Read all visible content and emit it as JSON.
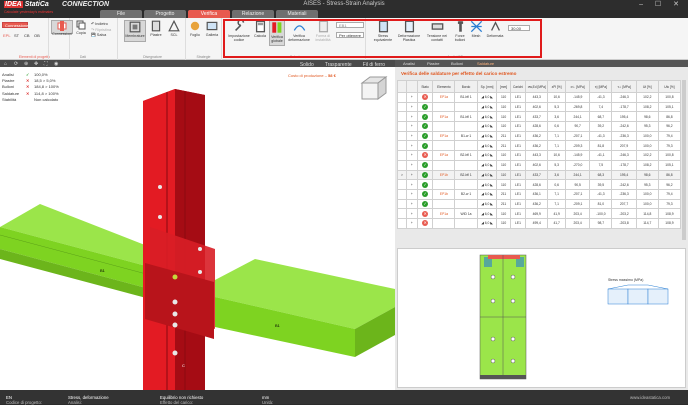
{
  "app": {
    "logo_ide": "IDEA",
    "logo_statica": "StatiCa",
    "logo_connection": "CONNECTION",
    "tagline": "Calculate yesterday's estimates",
    "window_title": "AISES - Stress-Strain Analysis",
    "window_controls": "– ☐ ✕"
  },
  "tabs": [
    "File",
    "Progetto",
    "Verifica",
    "Relazione",
    "Materiali"
  ],
  "ribbon": {
    "project_items": {
      "connection": "Connessione 1",
      "codes": [
        "EPL",
        "ST",
        "CB",
        "OB"
      ],
      "caption": "Elementi di progetto"
    },
    "data_group": {
      "connection_btn": "Connessioni",
      "copy_btn": "Copia",
      "indietro": "Indietro",
      "ripristina": "Ripristina",
      "salva": "Salva",
      "caption": "Dati"
    },
    "display_group": {
      "btn1": "Membrature",
      "btn2": "Piastre",
      "btn3": "SCL",
      "caption": "Disegnatore"
    },
    "view_group": {
      "btn1": "Foglio",
      "btn2": "Galleria",
      "caption": "Strategie"
    },
    "calc_group": {
      "btn_impostazione": "Impostazione codice",
      "btn_calcola": "Calcola",
      "btn_verifica_globale": "Verifica globale",
      "btn_verifica_deform": "Verifica deformazione",
      "btn_forma": "Forma di instabilità",
      "combo_material": "EB1",
      "combo_loadcase": "Per ottenere",
      "caption": "Calcolo"
    },
    "results_group": {
      "btn_stress": "Stress equivalente",
      "btn_deform": "Deformazione Plastica",
      "btn_tension": "Tensione nei contatti",
      "btn_forces": "Forze bulloni",
      "btn_mesh": "Mesh",
      "btn_deformed": "Deformata",
      "scale_value": "30.00",
      "caption": "Analisi EF"
    }
  },
  "viewport": {
    "toolbar_icons": [
      "house-icon",
      "rotate-icon",
      "zoom-icon",
      "pan-icon",
      "fit-icon",
      "camera-icon"
    ],
    "right_tabs": [
      "Solido",
      "Trasparente",
      "Fil di ferro"
    ],
    "production_cost_label": "Costo di produzione",
    "production_cost_value": "58 €",
    "member_labels": [
      "B1",
      "B1",
      "C"
    ]
  },
  "status": [
    {
      "label": "Analisi",
      "state": "ok",
      "value": "100,0%"
    },
    {
      "label": "Piastre",
      "state": "bad",
      "value": "18,5 > 5,0%"
    },
    {
      "label": "Bulloni",
      "state": "bad",
      "value": "184,8 > 100%"
    },
    {
      "label": "Saldature",
      "state": "bad",
      "value": "114,8 > 100%"
    },
    {
      "label": "Stabilità",
      "state": "none",
      "value": "Non calcolato"
    }
  ],
  "right_tabs": [
    "Analisi",
    "Piastre",
    "Bulloni",
    "Saldature"
  ],
  "right_active_tab": "Saldature",
  "table": {
    "title": "Verifica delle saldature per effetto del carico estremo",
    "headers": [
      "",
      "",
      "Stato",
      "Elemento",
      "Bordo",
      "Sp. [mm]",
      "[mm]",
      "Carichi",
      "σw,Ed [MPa]",
      "εPl [%]",
      "σ⊥ [MPa]",
      "τ∥ [MPa]",
      "τ⊥ [MPa]",
      "Ut [%]",
      "Utc [%]"
    ],
    "rows": [
      [
        "",
        "+",
        "bad",
        "EP1a",
        "B1-bfl 1",
        "◢ 6,0 ◣",
        "110",
        "LE1",
        "443,3",
        "10,6",
        "-145,9",
        "-41,3",
        "-246,3",
        "102,2",
        "100,8"
      ],
      [
        "",
        "+",
        "ok",
        "",
        "",
        "◢ 6,0 ◣",
        "110",
        "LE1",
        "402,6",
        "5,3",
        "-269,8",
        "7,4",
        "-178,7",
        "108,2",
        "105,1"
      ],
      [
        "",
        "+",
        "ok",
        "EP1a",
        "B1-bfl 1",
        "◢ 6,0 ◣",
        "110",
        "LE1",
        "433,7",
        "3,6",
        "244,1",
        "68,7",
        "195,4",
        "98,6",
        "86,8"
      ],
      [
        "",
        "+",
        "ok",
        "",
        "",
        "◢ 6,0 ◣",
        "110",
        "LE1",
        "428,6",
        "0,6",
        "90,7",
        "39,2",
        "-242,6",
        "95,3",
        "96,2"
      ],
      [
        "",
        "+",
        "ok",
        "EP1a",
        "B1-w 1",
        "◢ 6,0 ◣",
        "211",
        "LE1",
        "436,2",
        "7,1",
        "-207,1",
        "-41,3",
        "-236,3",
        "100,0",
        "79,4"
      ],
      [
        "",
        "+",
        "ok",
        "",
        "",
        "◢ 6,0 ◣",
        "211",
        "LE1",
        "436,2",
        "7,1",
        "-209,3",
        "81,8",
        "207,9",
        "100,0",
        "79,3"
      ],
      [
        "",
        "+",
        "bad",
        "EP1a",
        "B2-bfl 1",
        "◢ 6,0 ◣",
        "110",
        "LE1",
        "443,3",
        "10,6",
        "-145,9",
        "-41,1",
        "-246,3",
        "102,2",
        "100,8"
      ],
      [
        "",
        "+",
        "ok",
        "",
        "",
        "◢ 6,0 ◣",
        "110",
        "LE1",
        "402,6",
        "5,3",
        "-270,0",
        "7,5",
        "-178,7",
        "108,2",
        "105,1"
      ],
      [
        ">",
        "+",
        "ok",
        "EP1b",
        "B2-bfl 1",
        "◢ 6,0 ◣",
        "110",
        "LE1",
        "433,7",
        "3,6",
        "244,1",
        "68,3",
        "195,4",
        "98,6",
        "86,8"
      ],
      [
        "",
        "+",
        "ok",
        "",
        "",
        "◢ 6,0 ◣",
        "110",
        "LE1",
        "428,6",
        "0,6",
        "90,5",
        "39,5",
        "-242,6",
        "95,3",
        "96,2"
      ],
      [
        "",
        "+",
        "ok",
        "EP1b",
        "B2-w 1",
        "◢ 6,0 ◣",
        "211",
        "LE1",
        "436,1",
        "7,1",
        "-207,1",
        "-41,3",
        "-236,3",
        "100,0",
        "79,4"
      ],
      [
        "",
        "+",
        "ok",
        "",
        "",
        "◢ 6,0 ◣",
        "211",
        "LE1",
        "436,2",
        "7,1",
        "-209,1",
        "81,0",
        "207,7",
        "100,0",
        "79,3"
      ],
      [
        "",
        "+",
        "bad",
        "EP1a",
        "WID 1a",
        "◢ 6,0 ◣",
        "110",
        "LE1",
        "469,9",
        "41,9",
        "203,4",
        "-100,0",
        "-203,2",
        "114,8",
        "108,9"
      ],
      [
        "",
        "+",
        "bad",
        "",
        "",
        "◢ 6,0 ◣",
        "110",
        "LE1",
        "499,4",
        "41,7",
        "203,4",
        "98,7",
        "-203,8",
        "114,7",
        "108,9"
      ]
    ]
  },
  "preview": {
    "label": "Stress massimo (MPa)"
  },
  "statusbar": {
    "code_label": "Codice di progetto:",
    "code_value": "EN",
    "analysis_label": "Analisi:",
    "analysis_value": "Stress, deformazione",
    "load_label": "Effetto del carico:",
    "load_value": "Equilibrio non richiesto",
    "units_label": "Unità:",
    "units_value": "mm",
    "website": "www.ideastatica.com"
  },
  "colors": {
    "accent": "#e85a4f",
    "ok": "#2a9d2a",
    "bad": "#d33333",
    "beam": "#7ed321",
    "column": "#e31b23"
  }
}
